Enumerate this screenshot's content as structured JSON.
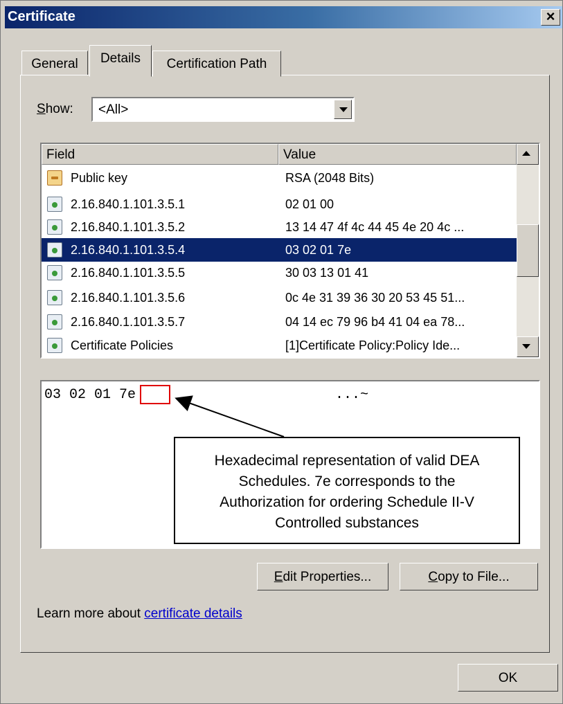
{
  "window": {
    "title": "Certificate",
    "close_glyph": "×"
  },
  "tabs": [
    {
      "label": "General",
      "active": false
    },
    {
      "label": "Details",
      "active": true
    },
    {
      "label": "Certification Path",
      "active": false
    }
  ],
  "show": {
    "label_accel": "S",
    "label_rest": "how:",
    "selected": "<All>"
  },
  "fields": {
    "headers": [
      "Field",
      "Value"
    ],
    "rows": [
      {
        "field": "Public key",
        "value": "RSA (2048 Bits)",
        "icon": "public-key-icon"
      },
      {
        "field": "2.16.840.1.101.3.5.1",
        "value": "02 01 00",
        "icon": "certificate-extension-icon"
      },
      {
        "field": "2.16.840.1.101.3.5.2",
        "value": "13 14 47 4f 4c 44 45 4e 20 4c ...",
        "icon": "certificate-extension-icon"
      },
      {
        "field": "2.16.840.1.101.3.5.4",
        "value": "03 02 01 7e",
        "icon": "certificate-extension-icon",
        "selected": true
      },
      {
        "field": "2.16.840.1.101.3.5.5",
        "value": "30 03 13 01 41",
        "icon": "certificate-extension-icon"
      },
      {
        "field": "2.16.840.1.101.3.5.6",
        "value": "0c 4e 31 39 36 30 20 53 45 51...",
        "icon": "certificate-extension-icon"
      },
      {
        "field": "2.16.840.1.101.3.5.7",
        "value": "04 14 ec 79 96 b4 41 04 ea 78...",
        "icon": "certificate-extension-icon"
      },
      {
        "field": "Certificate Policies",
        "value": "[1]Certificate Policy:Policy Ide...",
        "icon": "certificate-extension-icon"
      }
    ]
  },
  "detail": {
    "hex_prefix": "03 02 01 ",
    "hex_highlight": "7e",
    "ascii": "...~",
    "callout_lines": [
      "Hexadecimal representation of valid DEA",
      "Schedules. 7e corresponds to the",
      "Authorization for ordering Schedule II-V",
      "Controlled substances"
    ],
    "highlight_color": "#e00000"
  },
  "buttons": {
    "edit_accel": "E",
    "edit_rest": "dit Properties...",
    "copy_accel": "C",
    "copy_rest": "opy to File...",
    "ok": "OK"
  },
  "learn_more": {
    "prefix": "Learn more about ",
    "link": "certificate details"
  },
  "colors": {
    "titlebar_start": "#0a246a",
    "selection": "#0a246a",
    "dialog_bg": "#d4d0c8",
    "link": "#0000cc"
  }
}
